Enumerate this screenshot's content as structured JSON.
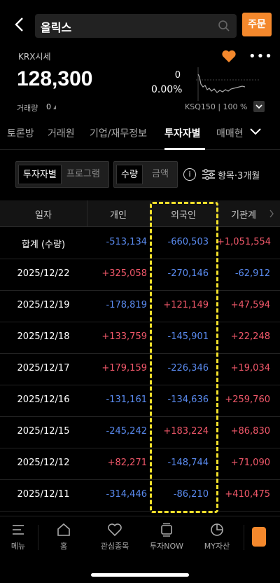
{
  "header": {
    "search_text": "올릭스",
    "order_label": "주문"
  },
  "quote": {
    "market_label": "KRX시세",
    "price": "128,300",
    "volume_label": "거래량",
    "volume_value": "0",
    "change": "0",
    "change_pct": "0.00%",
    "index_label": "KSQ150 | 100 %"
  },
  "tabs": [
    {
      "label": "토론방"
    },
    {
      "label": "거래원"
    },
    {
      "label": "기업/재무정보"
    },
    {
      "label": "투자자별"
    },
    {
      "label": "매매현"
    }
  ],
  "filters": {
    "seg1": [
      "투자자별",
      "프로그램"
    ],
    "seg2": [
      "수량",
      "금액"
    ],
    "info_icon": "i",
    "option_label": "항목·3개월"
  },
  "table": {
    "headers": [
      "일자",
      "개인",
      "외국인",
      "기관계"
    ],
    "rows": [
      {
        "date": "합계 (수량)",
        "individual": "-513,134",
        "foreign": "-660,503",
        "institution": "+1,051,554"
      },
      {
        "date": "2025/12/22",
        "individual": "+325,058",
        "foreign": "-270,146",
        "institution": "-62,912"
      },
      {
        "date": "2025/12/19",
        "individual": "-178,819",
        "foreign": "+121,149",
        "institution": "+47,594"
      },
      {
        "date": "2025/12/18",
        "individual": "+133,759",
        "foreign": "-145,901",
        "institution": "+22,248"
      },
      {
        "date": "2025/12/17",
        "individual": "+179,159",
        "foreign": "-226,346",
        "institution": "+19,034"
      },
      {
        "date": "2025/12/16",
        "individual": "-131,161",
        "foreign": "-134,636",
        "institution": "+259,760"
      },
      {
        "date": "2025/12/15",
        "individual": "-245,242",
        "foreign": "+183,224",
        "institution": "+86,830"
      },
      {
        "date": "2025/12/12",
        "individual": "+82,271",
        "foreign": "-148,744",
        "institution": "+71,090"
      },
      {
        "date": "2025/12/11",
        "individual": "-314,446",
        "foreign": "-86,210",
        "institution": "+410,475"
      }
    ]
  },
  "bottom_nav": [
    {
      "label": "메뉴"
    },
    {
      "label": "홈"
    },
    {
      "label": "관심종목"
    },
    {
      "label": "투자NOW"
    },
    {
      "label": "MY자산"
    }
  ],
  "colors": {
    "accent": "#f4882c",
    "positive": "#f2586a",
    "negative": "#5a8bf0",
    "highlight": "#f3e12b"
  }
}
